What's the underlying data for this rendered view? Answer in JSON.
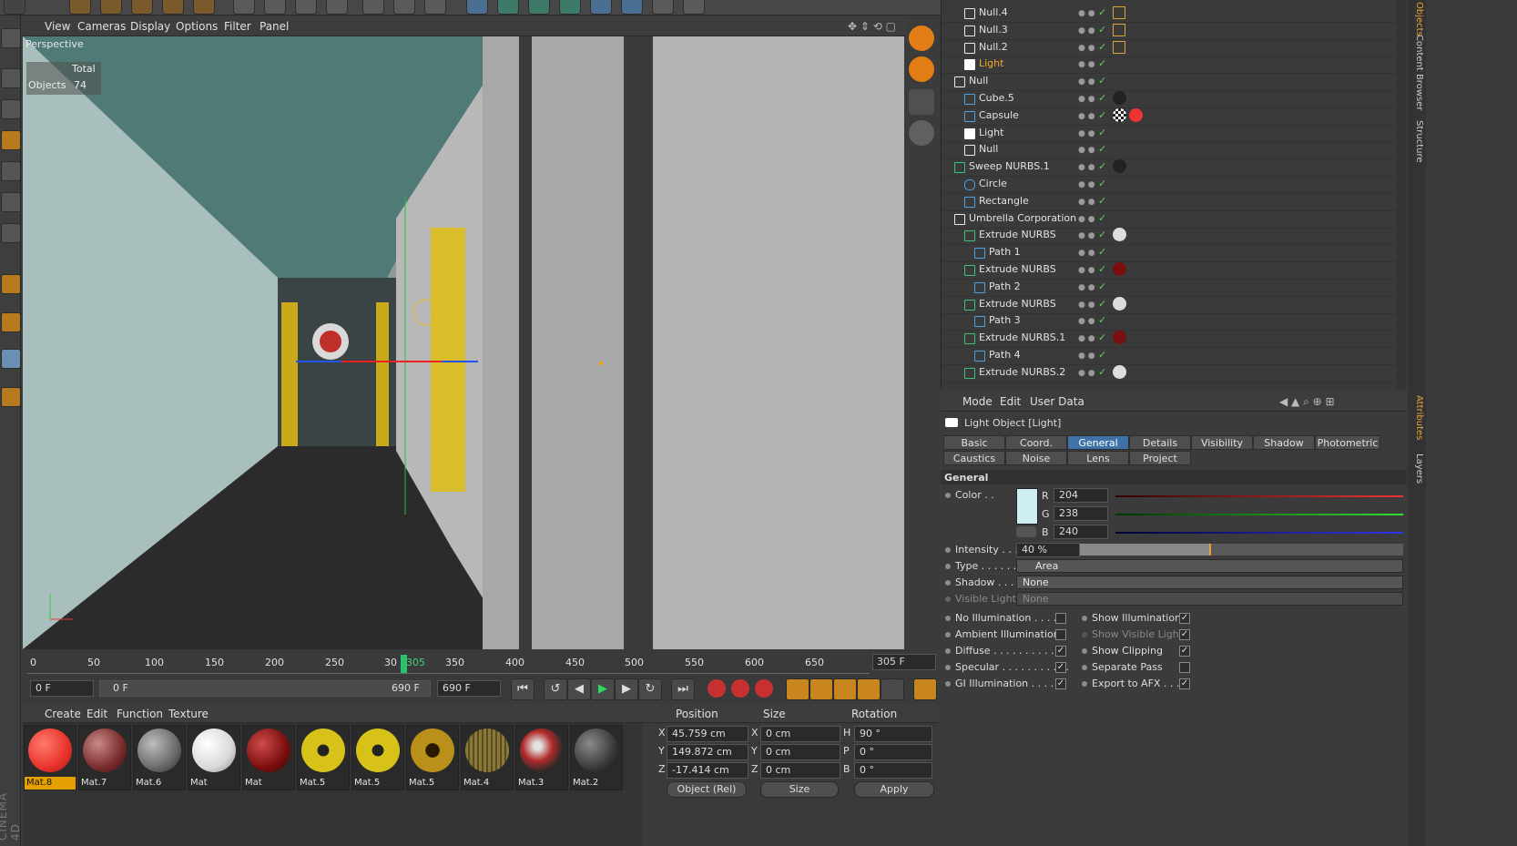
{
  "viewport": {
    "menu": [
      "View",
      "Cameras",
      "Display",
      "Options",
      "Filter",
      "Panel"
    ],
    "camera_label": "Perspective",
    "stats_total_label": "Total",
    "stats_objects_label": "Objects",
    "stats_objects_value": "74"
  },
  "timeline": {
    "ticks": [
      "0",
      "50",
      "100",
      "150",
      "200",
      "250",
      "30",
      "305",
      "350",
      "400",
      "450",
      "500",
      "550",
      "600",
      "650"
    ],
    "current_frame": "305",
    "end_frame": "305 F"
  },
  "transport": {
    "start_field": "0 F",
    "range_start": "0 F",
    "range_end": "690 F",
    "end_field": "690 F"
  },
  "material_manager": {
    "menu": [
      "Create",
      "Edit",
      "Function",
      "Texture"
    ],
    "materials": [
      {
        "label": "Mat.8",
        "color": "#e8332a",
        "selected": true
      },
      {
        "label": "Mat.7",
        "color": "#7a2b2b"
      },
      {
        "label": "Mat.6",
        "color": "#6a6a6a"
      },
      {
        "label": "Mat",
        "color": "#d9d9d9"
      },
      {
        "label": "Mat",
        "color": "#7a0f0f"
      },
      {
        "label": "Mat.5",
        "color": "#d8c21a"
      },
      {
        "label": "Mat.5",
        "color": "#d8c21a"
      },
      {
        "label": "Mat.5",
        "color": "#b8901a"
      },
      {
        "label": "Mat.4",
        "color": "#8a7a3a"
      },
      {
        "label": "Mat.3",
        "color": "#b22a2a"
      },
      {
        "label": "Mat.2",
        "color": "#3a3a3a"
      }
    ]
  },
  "coordinates": {
    "headers": {
      "position": "Position",
      "size": "Size",
      "rotation": "Rotation"
    },
    "rows": [
      {
        "axis": "X",
        "pos": "45.759 cm",
        "size_axis": "X",
        "size": "0 cm",
        "rot_axis": "H",
        "rot": "90 °"
      },
      {
        "axis": "Y",
        "pos": "149.872 cm",
        "size_axis": "Y",
        "size": "0 cm",
        "rot_axis": "P",
        "rot": "0 °"
      },
      {
        "axis": "Z",
        "pos": "-17.414 cm",
        "size_axis": "Z",
        "size": "0 cm",
        "rot_axis": "B",
        "rot": "0 °"
      }
    ],
    "mode_select": "Object (Rel)",
    "size_select": "Size",
    "apply_label": "Apply"
  },
  "object_manager": {
    "rows": [
      {
        "name": "Null.4",
        "indent": 1,
        "icon": "null",
        "tags": [
          "box"
        ]
      },
      {
        "name": "Null.3",
        "indent": 1,
        "icon": "null",
        "tags": [
          "box"
        ]
      },
      {
        "name": "Null.2",
        "indent": 1,
        "icon": "null",
        "tags": [
          "box"
        ]
      },
      {
        "name": "Light",
        "indent": 1,
        "icon": "light",
        "highlight": true,
        "tags": []
      },
      {
        "name": "Null",
        "indent": 0,
        "icon": "null",
        "tags": []
      },
      {
        "name": "Cube.5",
        "indent": 1,
        "icon": "cube",
        "tags": [
          "dark"
        ]
      },
      {
        "name": "Capsule",
        "indent": 1,
        "icon": "capsule",
        "tags": [
          "checker",
          "red"
        ]
      },
      {
        "name": "Light",
        "indent": 1,
        "icon": "light",
        "tags": []
      },
      {
        "name": "Null",
        "indent": 1,
        "icon": "null",
        "tags": []
      },
      {
        "name": "Sweep NURBS.1",
        "indent": 0,
        "icon": "nurbs",
        "tags": [
          "dark"
        ]
      },
      {
        "name": "Circle",
        "indent": 1,
        "icon": "circle",
        "tags": []
      },
      {
        "name": "Rectangle",
        "indent": 1,
        "icon": "rect",
        "tags": []
      },
      {
        "name": "Umbrella Corporation",
        "indent": 0,
        "icon": "null",
        "tags": []
      },
      {
        "name": "Extrude NURBS",
        "indent": 1,
        "icon": "nurbs",
        "tags": [
          "white"
        ]
      },
      {
        "name": "Path 1",
        "indent": 2,
        "icon": "path",
        "tags": []
      },
      {
        "name": "Extrude NURBS",
        "indent": 1,
        "icon": "nurbs",
        "tags": [
          "darkred"
        ]
      },
      {
        "name": "Path 2",
        "indent": 2,
        "icon": "path",
        "tags": []
      },
      {
        "name": "Extrude NURBS",
        "indent": 1,
        "icon": "nurbs",
        "tags": [
          "white"
        ]
      },
      {
        "name": "Path 3",
        "indent": 2,
        "icon": "path",
        "tags": []
      },
      {
        "name": "Extrude NURBS.1",
        "indent": 1,
        "icon": "nurbs",
        "tags": [
          "darkred"
        ]
      },
      {
        "name": "Path 4",
        "indent": 2,
        "icon": "path",
        "tags": []
      },
      {
        "name": "Extrude NURBS.2",
        "indent": 1,
        "icon": "nurbs",
        "tags": [
          "white"
        ]
      }
    ]
  },
  "attributes": {
    "menu": [
      "Mode",
      "Edit",
      "User Data"
    ],
    "object_title": "Light Object [Light]",
    "tabs_row1": [
      "Basic",
      "Coord.",
      "General",
      "Details",
      "Visibility",
      "Shadow",
      "Photometric"
    ],
    "tabs_row2": [
      "Caustics",
      "Noise",
      "Lens",
      "Project"
    ],
    "active_tab": "General",
    "section": "General",
    "color_label": "Color . .",
    "color_swatch": "#cceef0",
    "r_label": "R",
    "r_value": "204",
    "g_label": "G",
    "g_value": "238",
    "b_label": "B",
    "b_value": "240",
    "intensity_label": "Intensity . . .",
    "intensity_value": "40 %",
    "intensity_fraction": 0.4,
    "type_label": "Type . . . . . .",
    "type_value": "Area",
    "shadow_label": "Shadow . . . .",
    "shadow_value": "None",
    "visible_light_label": "Visible Light",
    "visible_light_value": "None",
    "left_checks": [
      {
        "label": "No Illumination . . . . .",
        "checked": false
      },
      {
        "label": "Ambient Illumination",
        "checked": false
      },
      {
        "label": "Diffuse . . . . . . . . . . . .",
        "checked": true
      },
      {
        "label": "Specular . . . . . . . . . . .",
        "checked": true
      },
      {
        "label": "GI Illumination . . . . .",
        "checked": true
      }
    ],
    "right_checks": [
      {
        "label": "Show Illumination",
        "checked": true
      },
      {
        "label": "Show Visible Light",
        "checked": true,
        "dim": true
      },
      {
        "label": "Show Clipping",
        "checked": true
      },
      {
        "label": "Separate Pass",
        "checked": false
      },
      {
        "label": "Export to AFX . . . .",
        "checked": true
      }
    ]
  },
  "side_tabs": [
    "Objects",
    "Content Browser",
    "Structure",
    "Attributes",
    "Layers"
  ]
}
